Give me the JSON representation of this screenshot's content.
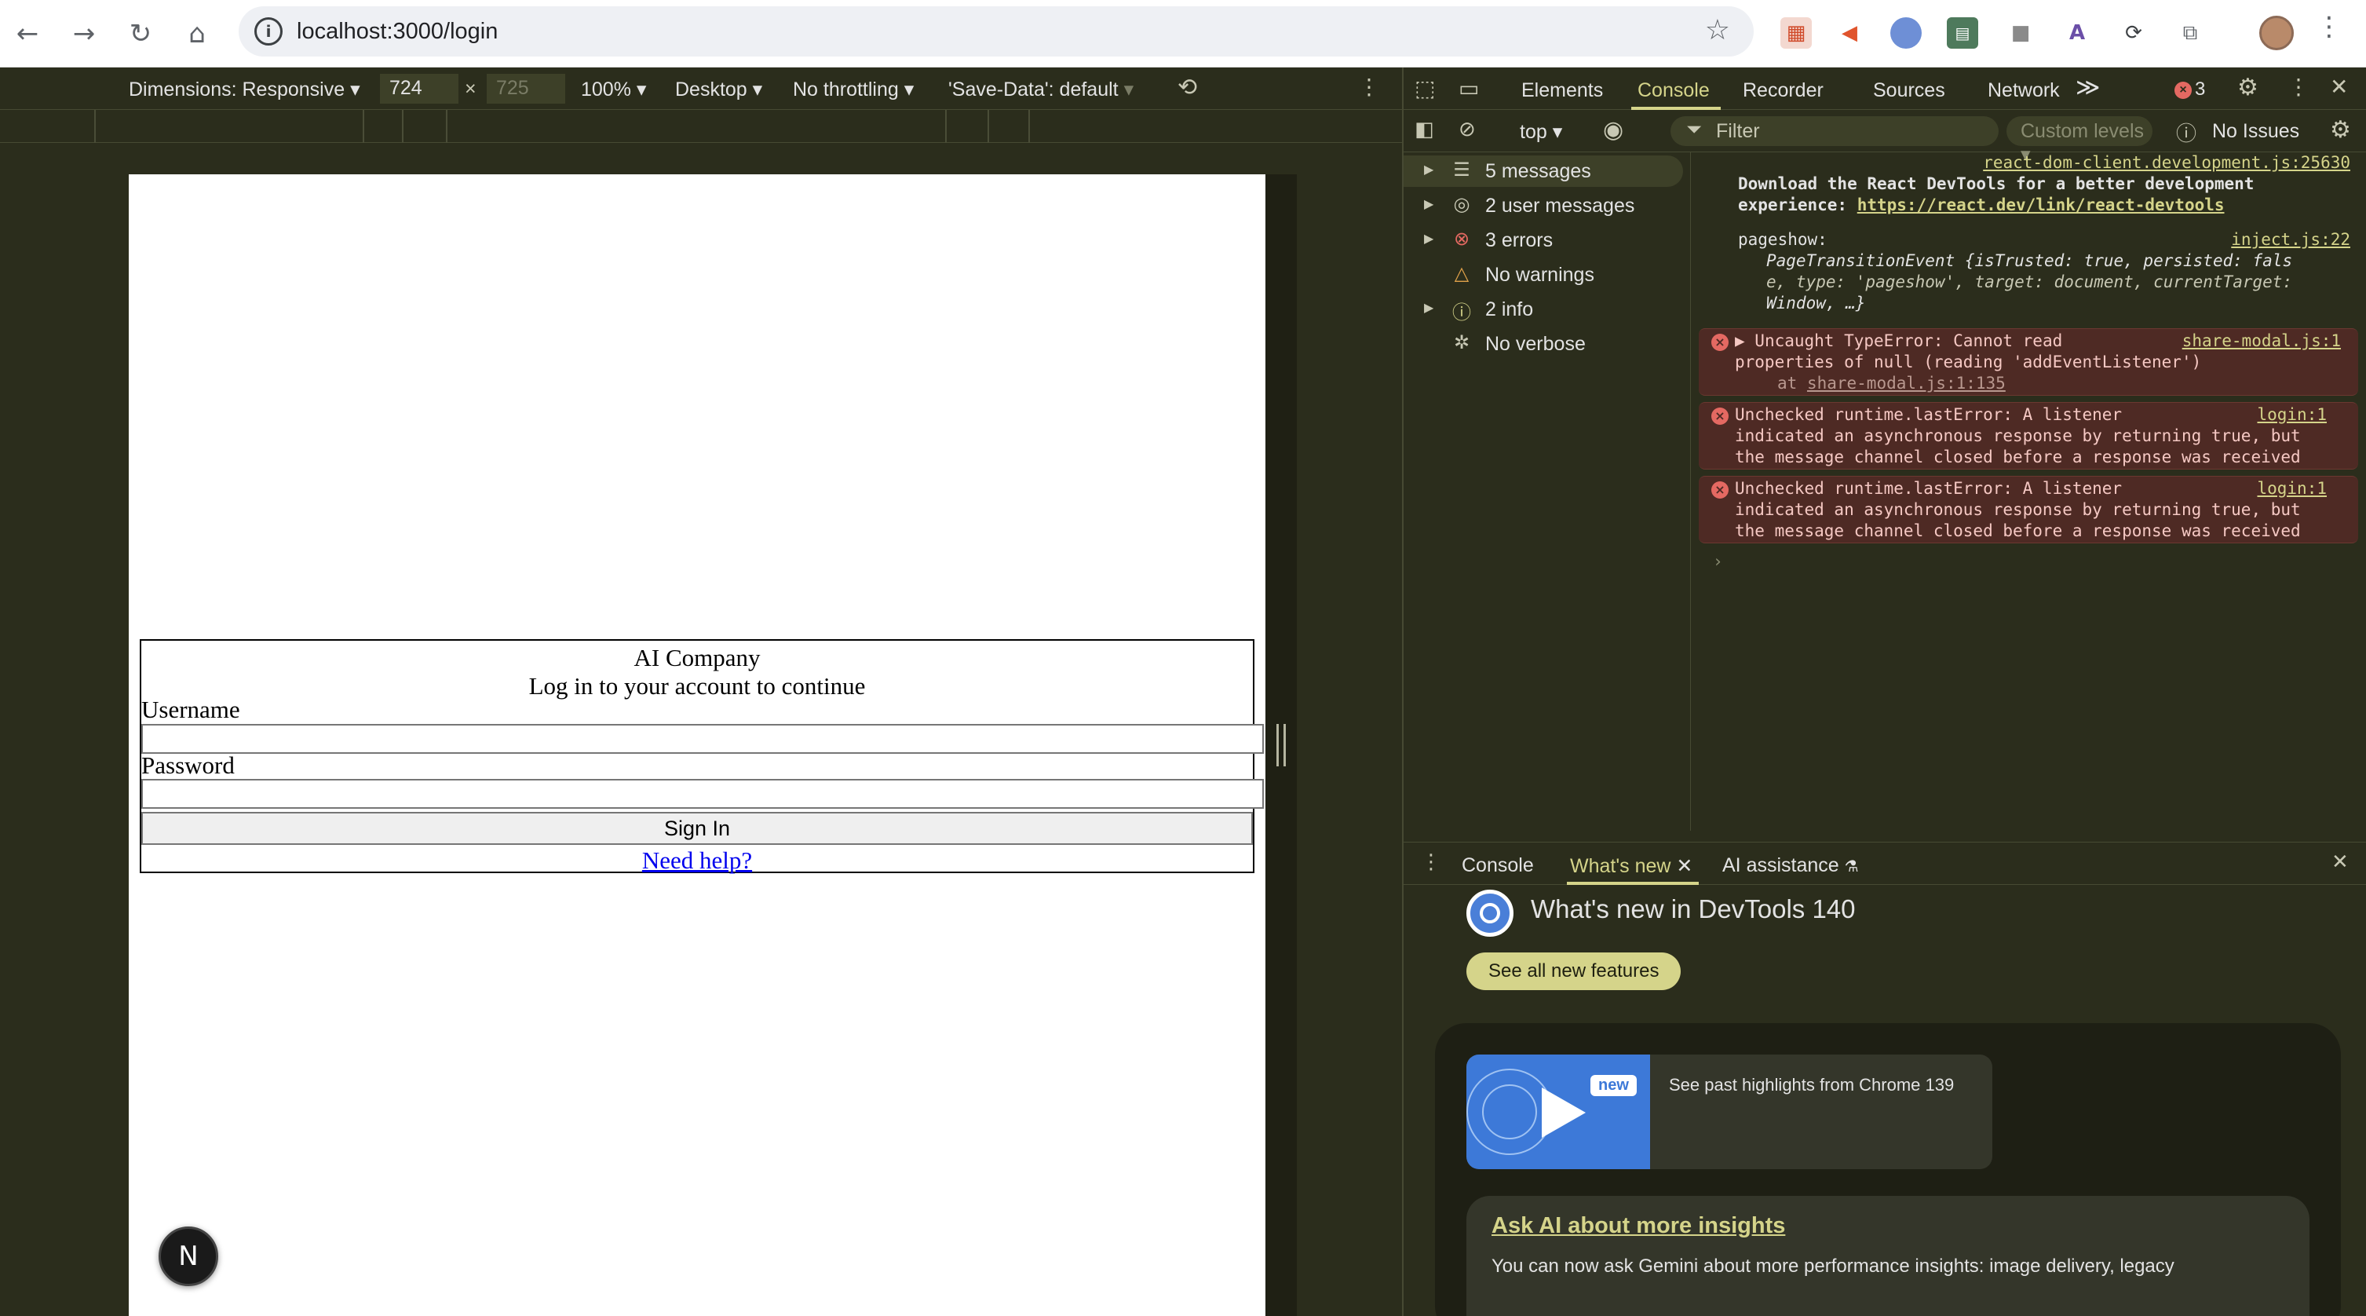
{
  "browser": {
    "url": "localhost:3000/login"
  },
  "device_toolbar": {
    "dimensions_label": "Dimensions: Responsive",
    "width": "724",
    "times": "×",
    "height_placeholder": "725",
    "zoom": "100%",
    "device_type": "Desktop",
    "throttling": "No throttling",
    "save_data": "'Save-Data': default"
  },
  "page": {
    "company": "AI Company",
    "subtitle": "Log in to your account to continue",
    "username_label": "Username",
    "password_label": "Password",
    "sign_in": "Sign In",
    "need_help": "Need help?",
    "nextjs_badge": "N"
  },
  "devtools": {
    "tabs": [
      "Elements",
      "Console",
      "Recorder",
      "Sources",
      "Network"
    ],
    "more_tabs": "≫",
    "error_count": "3",
    "console_toolbar": {
      "context": "top",
      "filter_placeholder": "Filter",
      "custom_levels": "Custom levels",
      "no_issues": "No Issues"
    },
    "sidebar": [
      {
        "label": "5 messages",
        "icon": "list-icon"
      },
      {
        "label": "2 user messages",
        "icon": "user-icon"
      },
      {
        "label": "3 errors",
        "icon": "error-icon"
      },
      {
        "label": "No warnings",
        "icon": "warning-icon"
      },
      {
        "label": "2 info",
        "icon": "info-icon"
      },
      {
        "label": "No verbose",
        "icon": "bug-icon"
      }
    ],
    "log": {
      "devtools_src": "react-dom-client.development.js:25630",
      "devtools_line1": "Download the React DevTools for a better development",
      "devtools_line2_prefix": "experience: ",
      "devtools_link": "https://react.dev/link/react-devtools",
      "pageshow_label": "pageshow:",
      "pageshow_src": "inject.js:22",
      "pageshow_line1": "PageTransitionEvent {isTrusted: true, persisted: fals",
      "pageshow_line2": "e, type: 'pageshow', target: document, currentTarget:",
      "pageshow_line3": "Window, …}",
      "err1_line1": "Uncaught TypeError: Cannot read",
      "err1_line2": "properties of null (reading 'addEventListener')",
      "err1_at": "at ",
      "err1_at_link": "share-modal.js:1:135",
      "err1_src": "share-modal.js:1",
      "err2_line1": "Unchecked runtime.lastError: A listener",
      "err2_line2": "indicated an asynchronous response by returning true, but",
      "err2_line3": "the message channel closed before a response was received",
      "err2_src": "login:1",
      "err3_line1": "Unchecked runtime.lastError: A listener",
      "err3_line2": "indicated an asynchronous response by returning true, but",
      "err3_line3": "the message channel closed before a response was received",
      "err3_src": "login:1",
      "prompt": "›"
    },
    "drawer": {
      "tabs": [
        "Console",
        "What's new",
        "AI assistance"
      ],
      "whats_new_title": "What's new in DevTools 140",
      "see_all": "See all new features",
      "highlight_badge": "new",
      "highlight_text": "See past highlights from Chrome 139",
      "ask_ai_link": "Ask AI about more insights",
      "ask_ai_body": "You can now ask Gemini about more performance insights: image delivery, legacy"
    }
  }
}
